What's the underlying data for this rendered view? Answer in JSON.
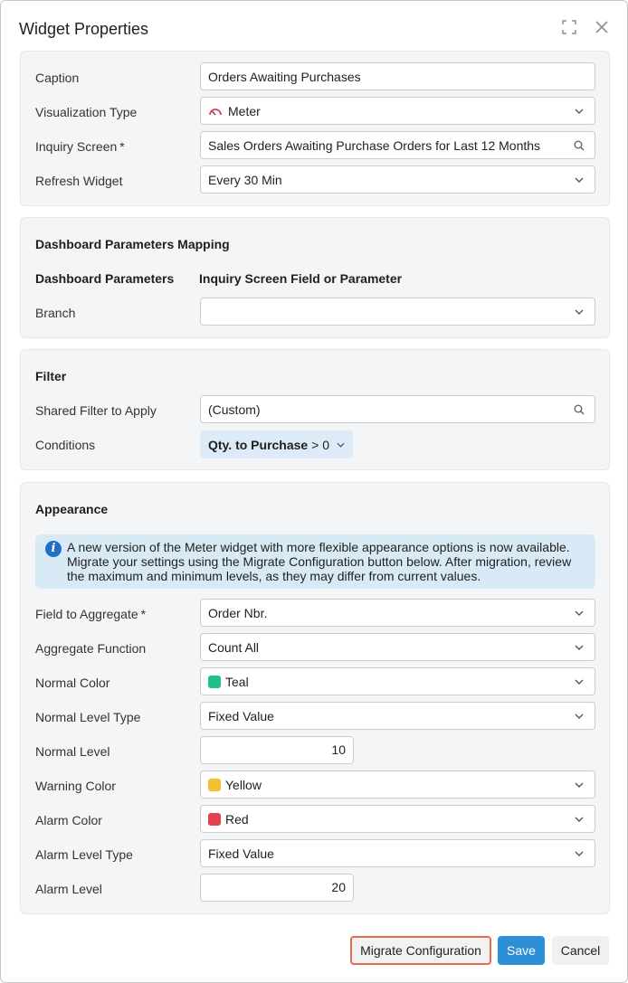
{
  "dialog": {
    "title": "Widget Properties",
    "icons": {
      "maximize": "maximize-icon",
      "close": "close-icon"
    }
  },
  "general": {
    "caption_label": "Caption",
    "caption_value": "Orders Awaiting Purchases",
    "viz_label": "Visualization Type",
    "viz_value": "Meter",
    "viz_icon": "meter-gauge-icon",
    "inquiry_label": "Inquiry Screen",
    "inquiry_required": "*",
    "inquiry_value": "Sales Orders Awaiting Purchase Orders for Last 12 Months",
    "refresh_label": "Refresh Widget",
    "refresh_value": "Every 30 Min"
  },
  "mapping": {
    "title": "Dashboard Parameters Mapping",
    "col_params": "Dashboard Parameters",
    "col_field": "Inquiry Screen Field or Parameter",
    "branch_label": "Branch",
    "branch_value": ""
  },
  "filter": {
    "title": "Filter",
    "shared_label": "Shared Filter to Apply",
    "shared_value": "(Custom)",
    "conditions_label": "Conditions",
    "condition_field": "Qty. to Purchase",
    "condition_op": "> 0"
  },
  "appearance": {
    "title": "Appearance",
    "info": "A new version of the Meter widget with more flexible appearance options is now available. Migrate your settings using the Migrate Configuration button below. After migration, review the maximum and minimum levels, as they may differ from current values.",
    "field_label": "Field to Aggregate",
    "field_required": "*",
    "field_value": "Order Nbr.",
    "func_label": "Aggregate Function",
    "func_value": "Count All",
    "normal_color_label": "Normal Color",
    "normal_color_value": "Teal",
    "normal_color_hex": "#1fbf8f",
    "normal_type_label": "Normal Level Type",
    "normal_type_value": "Fixed Value",
    "normal_level_label": "Normal Level",
    "normal_level_value": "10",
    "warning_color_label": "Warning Color",
    "warning_color_value": "Yellow",
    "warning_color_hex": "#f2c031",
    "alarm_color_label": "Alarm Color",
    "alarm_color_value": "Red",
    "alarm_color_hex": "#e0404f",
    "alarm_type_label": "Alarm Level Type",
    "alarm_type_value": "Fixed Value",
    "alarm_level_label": "Alarm Level",
    "alarm_level_value": "20"
  },
  "buttons": {
    "migrate": "Migrate Configuration",
    "save": "Save",
    "cancel": "Cancel"
  }
}
